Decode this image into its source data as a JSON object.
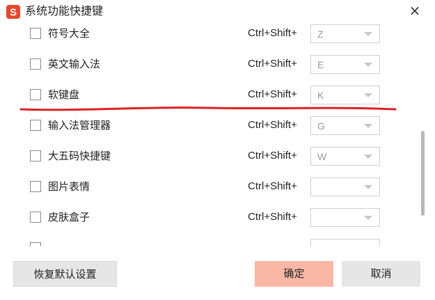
{
  "window": {
    "title": "系统功能快捷键",
    "logo_letter": "S",
    "close_glyph": "×"
  },
  "colors": {
    "logo": "#e8472a",
    "confirm_button": "#fbb7a5",
    "annotation_line": "#e02020"
  },
  "shortcuts": [
    {
      "label": "符号大全",
      "modifier": "Ctrl+Shift+",
      "key": "Z",
      "checked": false
    },
    {
      "label": "英文输入法",
      "modifier": "Ctrl+Shift+",
      "key": "E",
      "checked": false
    },
    {
      "label": "软键盘",
      "modifier": "Ctrl+Shift+",
      "key": "K",
      "checked": false
    },
    {
      "label": "输入法管理器",
      "modifier": "Ctrl+Shift+",
      "key": "G",
      "checked": false
    },
    {
      "label": "大五码快捷键",
      "modifier": "Ctrl+Shift+",
      "key": "W",
      "checked": false
    },
    {
      "label": "图片表情",
      "modifier": "Ctrl+Shift+",
      "key": "",
      "checked": false
    },
    {
      "label": "皮肤盒子",
      "modifier": "Ctrl+Shift+",
      "key": "",
      "checked": false
    },
    {
      "label": "",
      "modifier": "",
      "key": "",
      "checked": false
    }
  ],
  "buttons": {
    "reset": "恢复默认设置",
    "confirm": "确定",
    "cancel": "取消"
  }
}
